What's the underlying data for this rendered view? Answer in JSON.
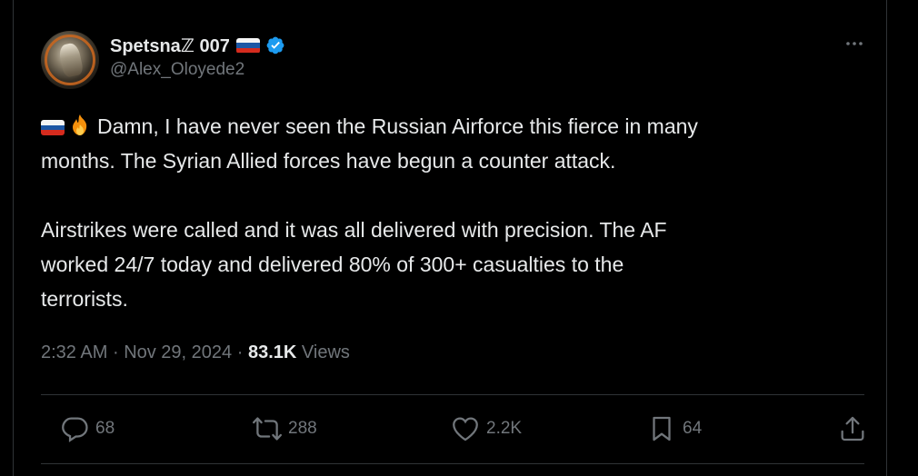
{
  "author": {
    "display_name": "Spetsnaℤ 007",
    "handle": "@Alex_Oloyede2",
    "verified": true,
    "flag": "russia-flag-icon"
  },
  "tweet": {
    "line1": "Damn, I have never seen the Russian Airforce this fierce in many",
    "line2": "months. The Syrian Allied forces have begun a counter attack.",
    "line3": "Airstrikes were called and it was all delivered with precision. The AF",
    "line4": "worked 24/7 today and delivered 80% of 300+ casualties to the",
    "line5": "terrorists."
  },
  "meta": {
    "time": "2:32 AM",
    "separator": "·",
    "date": "Nov 29, 2024",
    "views_count": "83.1K",
    "views_label": "Views"
  },
  "actions": {
    "replies": "68",
    "reposts": "288",
    "likes": "2.2K",
    "bookmarks": "64"
  },
  "colors": {
    "background": "#000000",
    "text": "#e7e9ea",
    "muted": "#71767b",
    "border": "#2f3336",
    "verified": "#1d9bf0"
  }
}
